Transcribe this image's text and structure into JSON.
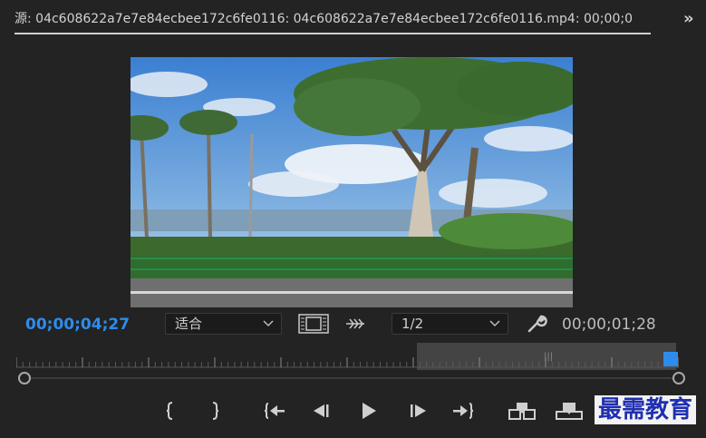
{
  "header": {
    "title": "源: 04c608622a7e7e84ecbee172c6fe0116: 04c608622a7e7e84ecbee172c6fe0116.mp4: 00;00;0",
    "overflow_icon": "double-chevron-right-icon"
  },
  "viewer": {
    "content": "video-frame"
  },
  "controls_row": {
    "current_timecode": "00;00;04;27",
    "zoom_select": "适合",
    "resolution_select": "1/2",
    "duration_timecode": "00;00;01;28",
    "colors": {
      "timecode_active": "#2d8ceb",
      "timecode_dim": "#bcbcbc"
    }
  },
  "timeline": {
    "accent": "#2d8ceb",
    "playhead_fraction": 0.98
  },
  "transport": {
    "buttons": [
      {
        "name": "mark-in-button",
        "icon": "mark-in-icon"
      },
      {
        "name": "mark-out-button",
        "icon": "mark-out-icon"
      },
      {
        "name": "go-to-in-button",
        "icon": "go-to-in-icon"
      },
      {
        "name": "step-back-button",
        "icon": "step-back-icon"
      },
      {
        "name": "play-button",
        "icon": "play-icon"
      },
      {
        "name": "step-forward-button",
        "icon": "step-forward-icon"
      },
      {
        "name": "go-to-out-button",
        "icon": "go-to-out-icon"
      },
      {
        "name": "insert-button",
        "icon": "insert-icon"
      },
      {
        "name": "overwrite-button",
        "icon": "overwrite-icon"
      }
    ]
  },
  "watermark": {
    "text": "最需教育"
  }
}
